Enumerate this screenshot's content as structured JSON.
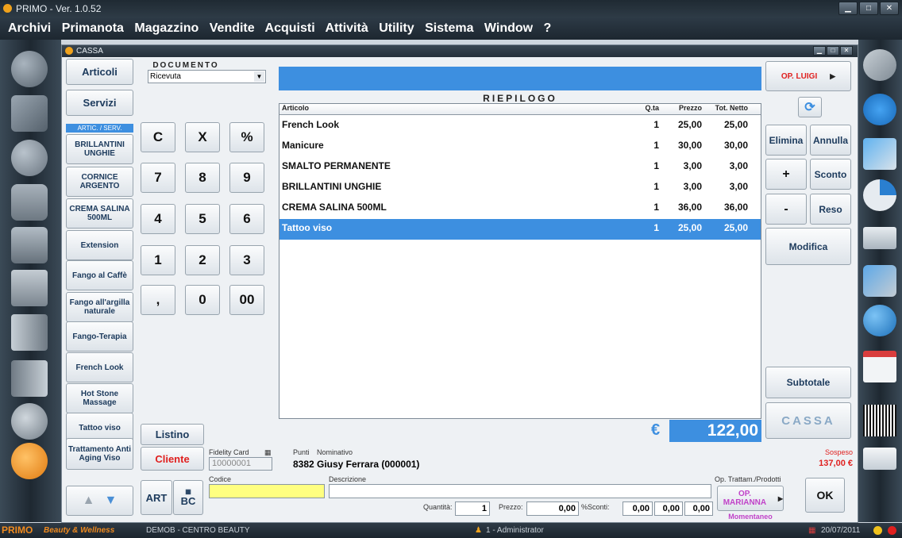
{
  "app": {
    "title": "PRIMO - Ver. 1.0.52",
    "window_title": "CASSA"
  },
  "menu": [
    "Archivi",
    "Primanota",
    "Magazzino",
    "Vendite",
    "Acquisti",
    "Attività",
    "Utility",
    "Sistema",
    "Window",
    "?"
  ],
  "buttons": {
    "articoli": "Articoli",
    "servizi": "Servizi",
    "section": "ARTIC. / SERV.",
    "listino": "Listino",
    "cliente": "Cliente",
    "art": "ART",
    "bc": "BC",
    "op_luigi": "OP. LUIGI",
    "elimina": "Elimina",
    "annulla": "Annulla",
    "plus": "+",
    "sconto": "Sconto",
    "minus": "-",
    "reso": "Reso",
    "modifica": "Modifica",
    "subtotale": "Subtotale",
    "cassa": "CASSA",
    "op_marianna": "OP. MARIANNA",
    "momentaneo": "Momentaneo",
    "ok": "OK"
  },
  "categories": [
    "BRILLANTINI UNGHIE",
    "CORNICE ARGENTO",
    "CREMA SALINA 500ML",
    "Extension",
    "Fango al Caffè",
    "Fango all'argilla naturale",
    "Fango-Terapia",
    "French Look",
    "Hot Stone Massage",
    "Tattoo viso",
    "Trattamento Anti Aging Viso"
  ],
  "keypad": [
    "C",
    "X",
    "%",
    "7",
    "8",
    "9",
    "4",
    "5",
    "6",
    "1",
    "2",
    "3",
    ",",
    "0",
    "00"
  ],
  "documento": {
    "label": "DOCUMENTO",
    "value": "Ricevuta"
  },
  "riepilogo": {
    "title": "RIEPILOGO",
    "columns": [
      "Articolo",
      "Q.ta",
      "Prezzo",
      "Tot. Netto"
    ],
    "rows": [
      {
        "articolo": "French Look",
        "qta": "1",
        "prezzo": "25,00",
        "tot": "25,00"
      },
      {
        "articolo": "Manicure",
        "qta": "1",
        "prezzo": "30,00",
        "tot": "30,00"
      },
      {
        "articolo": "SMALTO PERMANENTE",
        "qta": "1",
        "prezzo": "3,00",
        "tot": "3,00"
      },
      {
        "articolo": "BRILLANTINI UNGHIE",
        "qta": "1",
        "prezzo": "3,00",
        "tot": "3,00"
      },
      {
        "articolo": "CREMA SALINA 500ML",
        "qta": "1",
        "prezzo": "36,00",
        "tot": "36,00"
      },
      {
        "articolo": "Tattoo viso",
        "qta": "1",
        "prezzo": "25,00",
        "tot": "25,00"
      }
    ]
  },
  "total": {
    "currency": "€",
    "value": "122,00"
  },
  "customer": {
    "fidelity_label": "Fidelity Card",
    "fidelity_value": "10000001",
    "punti_label": "Punti",
    "punti_value": "8382",
    "nominativo_label": "Nominativo",
    "nominativo_value": "Giusy Ferrara (000001)",
    "sospeso_label": "Sospeso",
    "sospeso_value": "137,00 €"
  },
  "entry": {
    "codice_label": "Codice",
    "descrizione_label": "Descrizione",
    "op_label": "Op. Trattam./Prodotti",
    "quantita_label": "Quantità:",
    "quantita_value": "1",
    "prezzo_label": "Prezzo:",
    "prezzo_value": "0,00",
    "sconti_label": "%Sconti:",
    "sconto1": "0,00",
    "sconto2": "0,00",
    "sconto3": "0,00"
  },
  "status": {
    "brand": "PRIMO",
    "tagline": "Beauty & Wellness",
    "company": "DEMOB - CENTRO BEAUTY",
    "user": "1 - Administrator",
    "date": "20/07/2011"
  },
  "colors": {
    "accent": "#3d8fe0",
    "cliente": "#e0201f"
  }
}
